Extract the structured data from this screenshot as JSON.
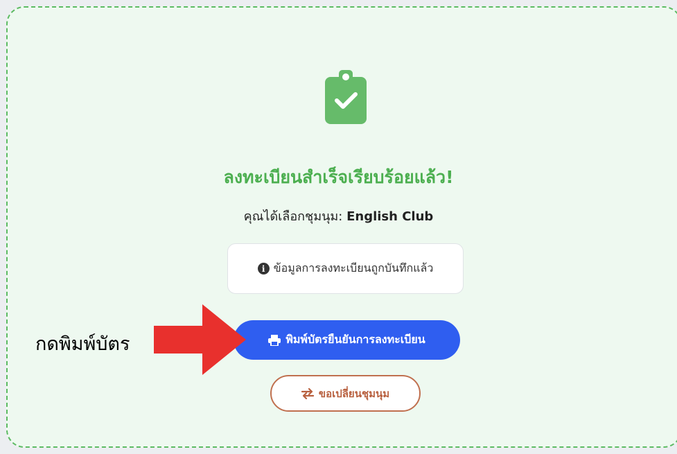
{
  "success": {
    "title": "ลงทะเบียนสำเร็จเรียบร้อยแล้ว!",
    "selected_prefix": "คุณได้เลือกชุมนุม: ",
    "selected_club": "English Club"
  },
  "info": {
    "icon": "info-circle-icon",
    "text": "ข้อมูลการลงทะเบียนถูกบันทึกแล้ว"
  },
  "buttons": {
    "print_label": "พิมพ์บัตรยืนยันการลงทะเบียน",
    "print_icon": "printer-icon",
    "change_label": "ขอเปลี่ยนชุมนุม",
    "change_icon": "exchange-arrows-icon"
  },
  "annotation": {
    "text": "กดพิมพ์บัตร",
    "arrow_color": "#e8302d"
  },
  "colors": {
    "accent_green": "#4caf50",
    "primary_blue": "#2f5ef0",
    "change_border": "#c0704f"
  }
}
